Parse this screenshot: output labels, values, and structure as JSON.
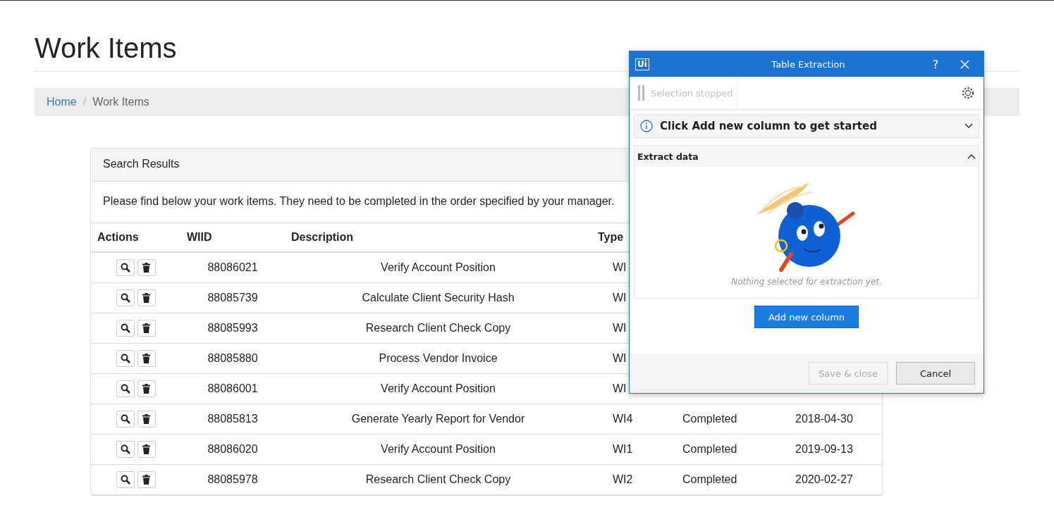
{
  "page": {
    "title": "Work Items"
  },
  "breadcrumb": [
    {
      "label": "Home",
      "kind": "link"
    },
    {
      "label": "/",
      "kind": "separator"
    },
    {
      "label": "Work Items",
      "kind": "current"
    }
  ],
  "card": {
    "title": "Search Results",
    "intro": "Please find below your work items. They need to be completed in the order specified by your manager."
  },
  "table": {
    "columns": [
      "Actions",
      "WIID",
      "Description",
      "Type"
    ],
    "rows": [
      {
        "wiid": "88086021",
        "description": "Verify Account Position",
        "type": "WI"
      },
      {
        "wiid": "88085739",
        "description": "Calculate Client Security Hash",
        "type": "WI"
      },
      {
        "wiid": "88085993",
        "description": "Research Client Check Copy",
        "type": "WI"
      },
      {
        "wiid": "88085880",
        "description": "Process Vendor Invoice",
        "type": "WI"
      },
      {
        "wiid": "88086001",
        "description": "Verify Account Position",
        "type": "WI"
      },
      {
        "wiid": "88085813",
        "description": "Generate Yearly Report for Vendor",
        "type": "WI4",
        "status": "Completed",
        "date": "2018-04-30"
      },
      {
        "wiid": "88086020",
        "description": "Verify Account Position",
        "type": "WI1",
        "status": "Completed",
        "date": "2019-09-13"
      },
      {
        "wiid": "88085978",
        "description": "Research Client Check Copy",
        "type": "WI2",
        "status": "Completed",
        "date": "2020-02-27"
      }
    ]
  },
  "dialog": {
    "logo": "Ui",
    "title": "Table Extraction",
    "help": "?",
    "selection": {
      "label": "Selection stopped",
      "disabled": true
    },
    "info": {
      "text": "Click Add new column to get started",
      "expanded": false
    },
    "section": {
      "title": "Extract data",
      "expanded": true,
      "empty_message": "Nothing selected for extraction yet."
    },
    "add_button": "Add new column",
    "buttons": [
      {
        "label": "Save & close",
        "disabled": true
      },
      {
        "label": "Cancel",
        "disabled": false
      }
    ]
  }
}
